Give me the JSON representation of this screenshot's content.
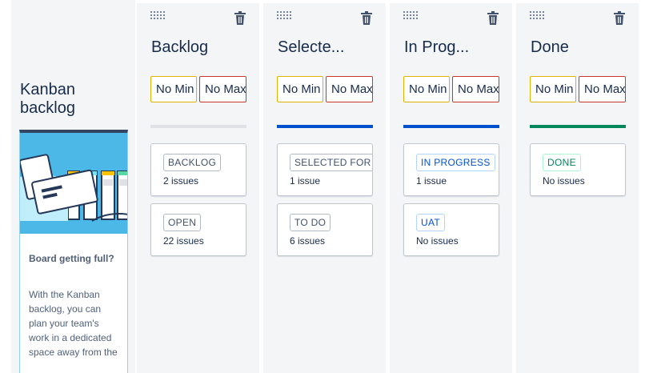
{
  "sidebar": {
    "title": "Kanban backlog",
    "card_heading": "Board getting full?",
    "card_body": "With the Kanban backlog, you can plan your team's work in a dedicated space away from the"
  },
  "columns": [
    {
      "name": "Backlog",
      "min_label": "No Min",
      "max_label": "No Max",
      "bar_color": "#dfe1e6",
      "statuses": [
        {
          "label": "BACKLOG",
          "count": "2 issues",
          "color": "grey"
        },
        {
          "label": "OPEN",
          "count": "22 issues",
          "color": "grey"
        }
      ]
    },
    {
      "name": "Selecte...",
      "min_label": "No Min",
      "max_label": "No Max",
      "bar_color": "#0052cc",
      "statuses": [
        {
          "label": "SELECTED FOR D",
          "count": "1 issue",
          "color": "grey"
        },
        {
          "label": "TO DO",
          "count": "6 issues",
          "color": "grey"
        }
      ]
    },
    {
      "name": "In Prog...",
      "min_label": "No Min",
      "max_label": "No Max",
      "bar_color": "#0052cc",
      "statuses": [
        {
          "label": "IN PROGRESS",
          "count": "1 issue",
          "color": "blue"
        },
        {
          "label": "UAT",
          "count": "No issues",
          "color": "blue"
        }
      ]
    },
    {
      "name": "Done",
      "min_label": "No Min",
      "max_label": "No Max",
      "bar_color": "#00875a",
      "statuses": [
        {
          "label": "DONE",
          "count": "No issues",
          "color": "green"
        }
      ]
    }
  ],
  "icons": {
    "drag": "drag-handle-icon",
    "delete": "trash-icon"
  },
  "colors": {
    "min_border": "#e2b203",
    "max_border": "#c9372c",
    "in_progress": "#0052cc",
    "done": "#00875a"
  }
}
